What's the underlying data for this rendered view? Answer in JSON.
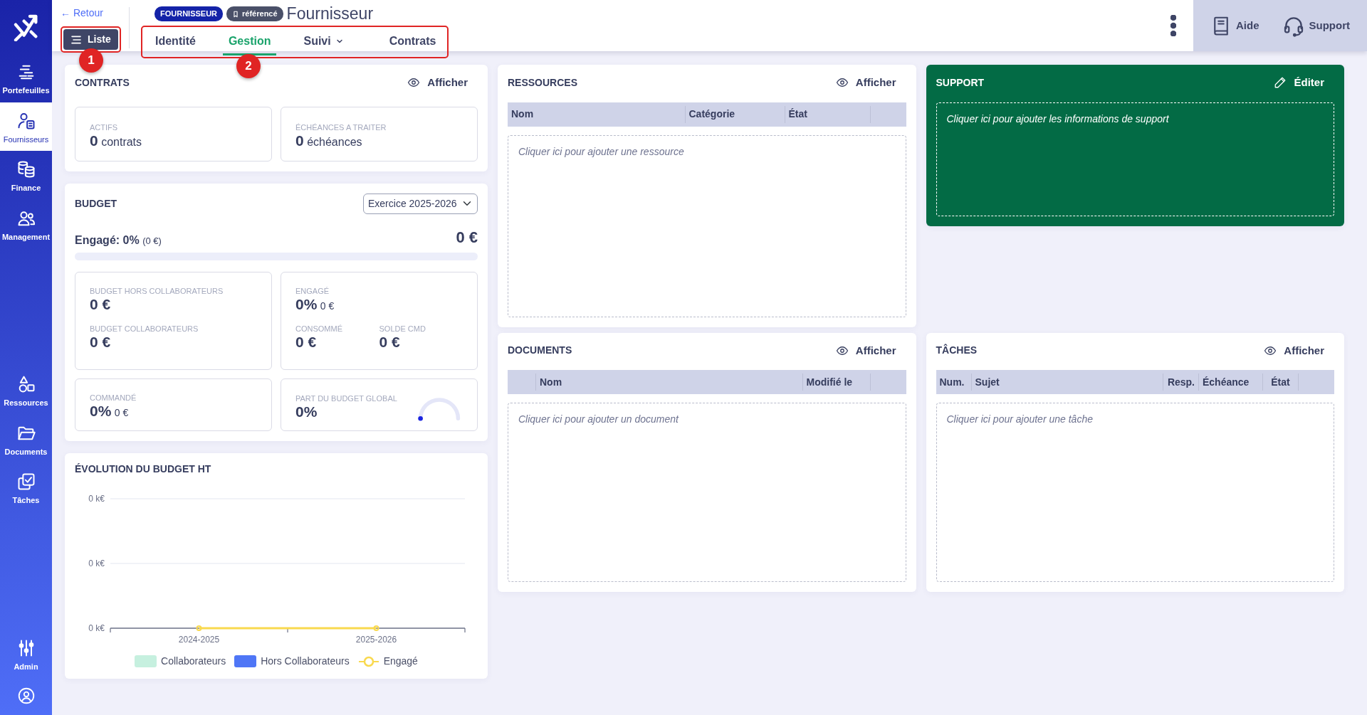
{
  "sidebar": {
    "groups": [
      {
        "items": [
          {
            "label": "Portefeuilles",
            "selected": false
          },
          {
            "label": "Fournisseurs",
            "selected": true
          },
          {
            "label": "Finance",
            "selected": false
          },
          {
            "label": "Management",
            "selected": false
          }
        ]
      },
      {
        "items": [
          {
            "label": "Ressources",
            "selected": false
          },
          {
            "label": "Documents",
            "selected": false
          },
          {
            "label": "Tâches",
            "selected": false
          }
        ]
      },
      {
        "items": [
          {
            "label": "Admin",
            "selected": false
          }
        ]
      }
    ]
  },
  "header": {
    "back_link": "← Retour",
    "list_button": "Liste",
    "badges": [
      {
        "text": "FOURNISSEUR",
        "kind": "type"
      },
      {
        "text": "référencé",
        "kind": "status"
      }
    ],
    "title": "Fournisseur",
    "tabs": [
      {
        "label": "Identité",
        "selected": false,
        "dropdown": false
      },
      {
        "label": "Gestion",
        "selected": true,
        "dropdown": false
      },
      {
        "label": "Suivi",
        "selected": false,
        "dropdown": true
      },
      {
        "label": "Contrats",
        "selected": false,
        "dropdown": false
      }
    ],
    "help": "Aide",
    "support": "Support"
  },
  "annotations": [
    {
      "label": "1"
    },
    {
      "label": "2"
    }
  ],
  "contrats": {
    "title": "CONTRATS",
    "action": "Afficher",
    "stats": [
      {
        "label": "ACTIFS",
        "value": "0",
        "unit": "contrats"
      },
      {
        "label": "ÉCHÉANCES A TRAITER",
        "value": "0",
        "unit": "échéances"
      }
    ]
  },
  "budget": {
    "title": "BUDGET",
    "select": "Exercice 2025-2026",
    "engaged_label": "Engagé: 0%",
    "engaged_amount": "(0 €)",
    "total": "0 €",
    "level": 0,
    "boxes": [
      {
        "kind": "stack",
        "metrics": [
          {
            "label": "BUDGET HORS COLLABORATEURS",
            "value": "0 €"
          },
          {
            "label": "BUDGET COLLABORATEURS",
            "value": "0 €"
          }
        ]
      },
      {
        "kind": "split",
        "metrics": [
          {
            "label": "ENGAGÉ",
            "value": "0%",
            "sub": "0 €"
          },
          {
            "label": "CONSOMMÉ",
            "value": "0 €"
          },
          {
            "label": "SOLDE CMD",
            "value": "0 €"
          }
        ]
      },
      {
        "kind": "stack",
        "metrics": [
          {
            "label": "COMMANDÉ",
            "value": "0%",
            "sub": "0 €"
          }
        ]
      },
      {
        "kind": "gauge",
        "level": 0,
        "metrics": [
          {
            "label": "PART DU BUDGET GLOBAL",
            "value": "0%"
          }
        ]
      }
    ]
  },
  "evolution": {
    "title": "ÉVOLUTION DU BUDGET HT",
    "chart_data": {
      "type": "line",
      "categories": [
        "2024-2025",
        "2025-2026"
      ],
      "ylim": [
        0,
        1
      ],
      "yticks": [
        {
          "value": 0,
          "label": "0 k€"
        },
        {
          "value": 0.5,
          "label": "0 k€"
        },
        {
          "value": 1,
          "label": "0 k€"
        }
      ],
      "series": [
        {
          "name": "Collaborateurs",
          "color": "#c6f0df",
          "values": [
            null,
            null
          ]
        },
        {
          "name": "Hors Collaborateurs",
          "color": "#4f76f6",
          "values": [
            null,
            null
          ]
        },
        {
          "name": "Engagé",
          "color": "#f9d94f",
          "marker": "circle",
          "values": [
            0,
            0
          ]
        }
      ],
      "legend": "bottom"
    }
  },
  "ressources": {
    "title": "RESSOURCES",
    "action": "Afficher",
    "select_column": false,
    "columns": [
      "Nom",
      "Catégorie",
      "État"
    ],
    "placeholder": "Cliquer ici pour ajouter une ressource"
  },
  "support": {
    "title": "SUPPORT",
    "action": "Éditer",
    "placeholder": "Cliquer ici pour ajouter les informations de support"
  },
  "documents": {
    "title": "DOCUMENTS",
    "action": "Afficher",
    "select_column": true,
    "columns": [
      "Nom",
      "Modifié le"
    ],
    "placeholder": "Cliquer ici pour ajouter un document"
  },
  "taches": {
    "title": "TÂCHES",
    "action": "Afficher",
    "select_column": false,
    "columns": [
      "Num.",
      "Sujet",
      "Resp.",
      "Échéance",
      "État"
    ],
    "placeholder": "Cliquer ici pour ajouter une tâche"
  }
}
